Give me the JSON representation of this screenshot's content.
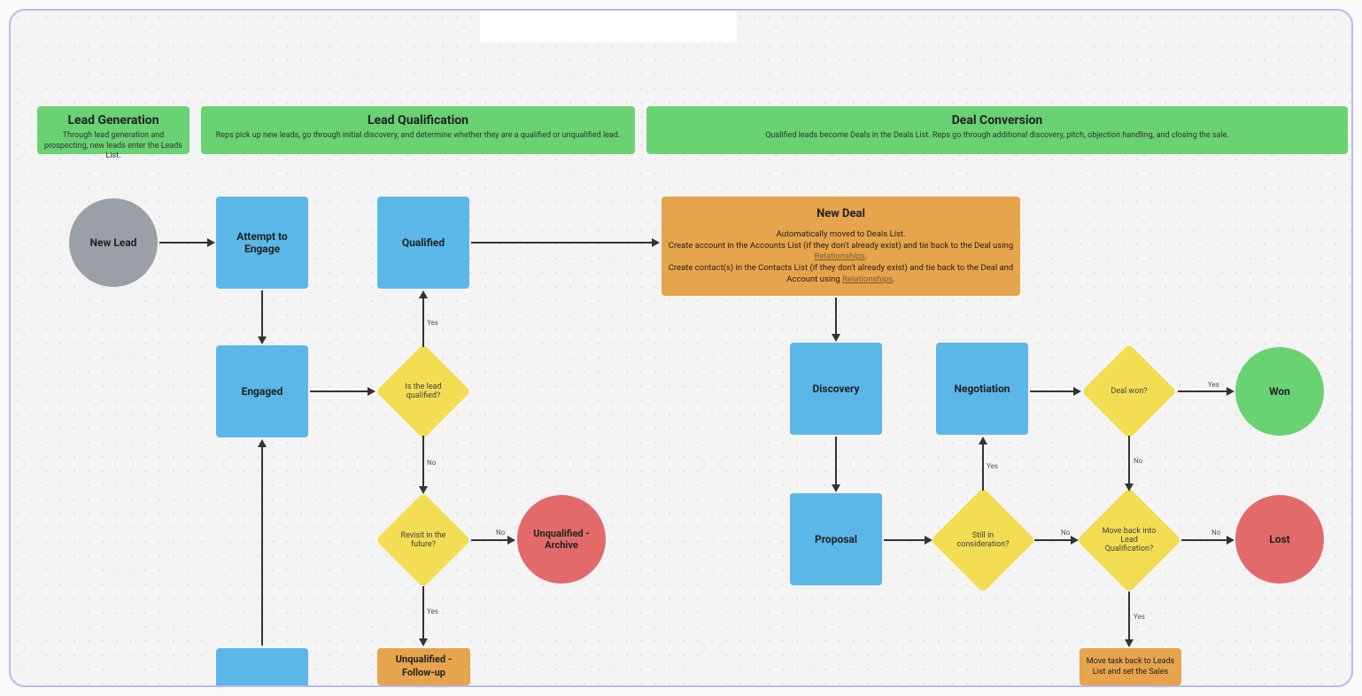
{
  "headers": {
    "leadGen": {
      "title": "Lead Generation",
      "desc": "Through lead generation and prospecting, new leads enter the Leads List."
    },
    "leadQual": {
      "title": "Lead Qualification",
      "desc": "Reps pick up new leads, go through initial discovery, and determine whether they are a qualified or unqualified lead."
    },
    "dealConv": {
      "title": "Deal Conversion",
      "desc": "Qualified leads become Deals in the Deals List. Reps go through additional discovery, pitch, objection handling, and closing the sale."
    }
  },
  "nodes": {
    "newLead": "New Lead",
    "attempt": "Attempt to Engage",
    "engaged": "Engaged",
    "qualified": "Qualified",
    "isQualified": "Is the lead qualified?",
    "revisit": "Revisit in the future?",
    "unqualArchive": "Unqualified - Archive",
    "unqualFollow": "Unqualified - Follow-up",
    "newDeal": {
      "title": "New Deal",
      "l1": "Automatically moved to Deals List.",
      "l2a": "Create account in the Accounts List (if they don't already exist) and tie back to the Deal using ",
      "l2b": ".",
      "link1": "Relationships",
      "l3a": "Create contact(s) in the Contacts List (if they don't already exist) and tie back to the Deal and Account using ",
      "l3b": ".",
      "link2": "Relationships"
    },
    "discovery": "Discovery",
    "proposal": "Proposal",
    "negotiation": "Negotiation",
    "stillConsider": "Still in consideration?",
    "dealWon": "Deal won?",
    "moveBack": "Move back into Lead Qualification?",
    "won": "Won",
    "lost": "Lost",
    "moveTask": "Move task back to Leads List and set the Sales"
  },
  "labels": {
    "yes": "Yes",
    "no": "No"
  }
}
